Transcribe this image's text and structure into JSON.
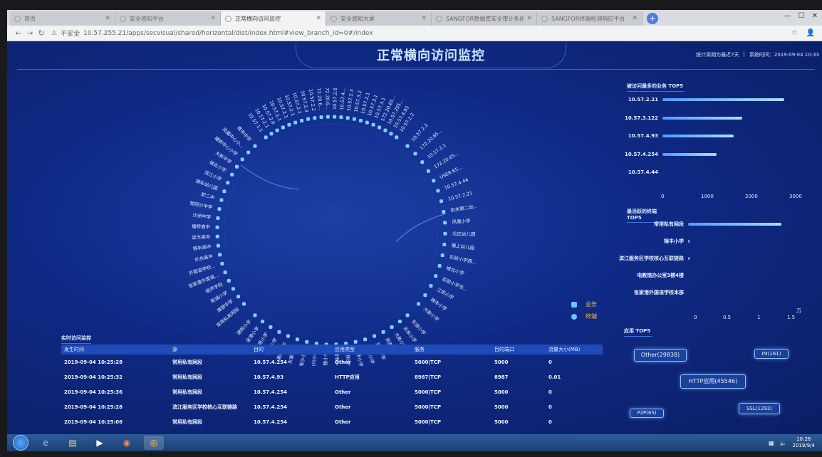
{
  "browser": {
    "tabs": [
      {
        "label": "首页",
        "active": false
      },
      {
        "label": "安全感知平台",
        "active": false
      },
      {
        "label": "正常横向访问监控",
        "active": true
      },
      {
        "label": "安全感知大屏",
        "active": false
      },
      {
        "label": "SANGFOR数据库安全审计系统",
        "active": false
      },
      {
        "label": "SANGFOR终端检测响应平台",
        "active": false
      }
    ],
    "security_label": "不安全",
    "url": "10.57.255.21/apps/secvisual/shared/horizontal/dist/index.html#view_branch_id=0#/index"
  },
  "dashboard": {
    "title": "正常横向访问监控",
    "period": "统计周期为最近7天",
    "system_time": "系统时间：2019-09-04 10:33"
  },
  "ring": {
    "nodes_left": [
      "常用私有网段",
      "浦驿中学",
      "新城小学",
      "振声学校",
      "张家港外国语...",
      "外国语学校...",
      "乐余高中",
      "锦丰高中",
      "梁丰高中",
      "塘桥高中",
      "沙洲中学",
      "常阴沙中学",
      "职二中",
      "旗彩幼儿园",
      "滨江小学",
      "城北小学",
      "大新中学",
      "塘桥中心小学",
      "凤凰中心小...",
      "南丰中学"
    ],
    "nodes_top": [
      "10.57.1.1",
      "10.57.2.1",
      "10.57.2.6",
      "10.57.1.1",
      "10.57.2.1",
      "10.57.2.1",
      "10.57.2.2",
      "10.57.2.3",
      "10.57.2.2",
      "172.20.6...",
      "172.20.6...",
      "10.57.2.8",
      "10.57.4...",
      "10.57.2.3",
      "10.57.3.2",
      "10.57.2.1",
      "10.57.3.1",
      "10.57.3.1",
      "172.20.65...",
      "10.57.255...",
      "10.57.4.93",
      "10.57.2.2"
    ],
    "nodes_right": [
      "10.57.2.2",
      "172.20.65...",
      "10.57.2.1",
      "172.20.65...",
      "USER-K5...",
      "10.57.4.44",
      "10.57.2.21",
      "机关第二幼...",
      "凤凰小学",
      "北庄幼儿园",
      "塘上幼儿园",
      "实验小学西...",
      "城北小学",
      "实验小学东...",
      "江帆小学",
      "锦丰小学",
      "大新小学"
    ],
    "nodes_bottom": [
      "东渡小学",
      "乐余小学",
      "大新小学",
      "凤凰小学",
      "实验小学",
      "港区小学",
      "兆丰小学",
      "常阴沙小学",
      "塘市小学",
      "后塍小学",
      "合兴小学",
      "南沙小学",
      "东莱小学",
      "晨阳小学",
      "妙桥小学",
      "鹿苑小学",
      "金港小学",
      "德积小学"
    ]
  },
  "legend": {
    "business": "业务",
    "terminal": "终端"
  },
  "top_business": {
    "title": "被访问最多的业务 TOP5",
    "items": [
      {
        "label": "10.57.2.21",
        "value": 2750
      },
      {
        "label": "10.57.3.122",
        "value": 1800
      },
      {
        "label": "10.57.4.93",
        "value": 1620
      },
      {
        "label": "10.57.4.254",
        "value": 1230
      },
      {
        "label": "10.57.4.44",
        "value": 0
      }
    ],
    "ticks": [
      "0",
      "1000",
      "2000",
      "3000"
    ]
  },
  "top_terminal": {
    "title": "最活跃的终端 TOP5",
    "items": [
      {
        "label": "常用私有网段",
        "value": 1.4
      },
      {
        "label": "锦丰小学",
        "value": 0.02
      },
      {
        "label": "滨江服务区学校核心互联链路",
        "value": 0.02
      },
      {
        "label": "电教馆办公室3楼4楼",
        "value": 0
      },
      {
        "label": "张家港外国语学校本部",
        "value": 0
      }
    ],
    "ticks": [
      "0",
      "0.5",
      "1",
      "1.5"
    ],
    "unit": "万"
  },
  "apps": {
    "title": "应用 TOP5",
    "items": [
      "Other(29838)",
      "IM(161)",
      "HTTP应用(45546)",
      "P2P(65)",
      "SSL(1292)"
    ]
  },
  "realtime": {
    "title": "实时访问监控",
    "columns": [
      "发生时间",
      "源",
      "目的",
      "应用类型",
      "服务",
      "目的端口",
      "流量大小(MB)"
    ],
    "rows": [
      [
        "2019-09-04 10:25:28",
        "常用私有网段",
        "10.57.4.254",
        "Other",
        "5000|TCP",
        "5000",
        "0"
      ],
      [
        "2019-09-04 10:25:32",
        "常用私有网段",
        "10.57.4.93",
        "HTTP应用",
        "8987|TCP",
        "8987",
        "0.01"
      ],
      [
        "2019-09-04 10:25:36",
        "常用私有网段",
        "10.57.4.254",
        "Other",
        "5000|TCP",
        "5000",
        "0"
      ],
      [
        "2019-09-04 10:25:28",
        "滨江服务区学校核心互联链路",
        "10.57.4.254",
        "Other",
        "5000|TCP",
        "5000",
        "0"
      ],
      [
        "2019-09-04 10:25:06",
        "常用私有网段",
        "10.57.4.254",
        "Other",
        "5000|TCP",
        "5000",
        "0"
      ]
    ]
  },
  "taskbar": {
    "time": "10:26",
    "date": "2019/9/4"
  },
  "colors": {
    "background": "#0a1e63",
    "accent": "#6fc4ff",
    "legend_text": "#f7c244",
    "bar": "#5aa6ff"
  }
}
